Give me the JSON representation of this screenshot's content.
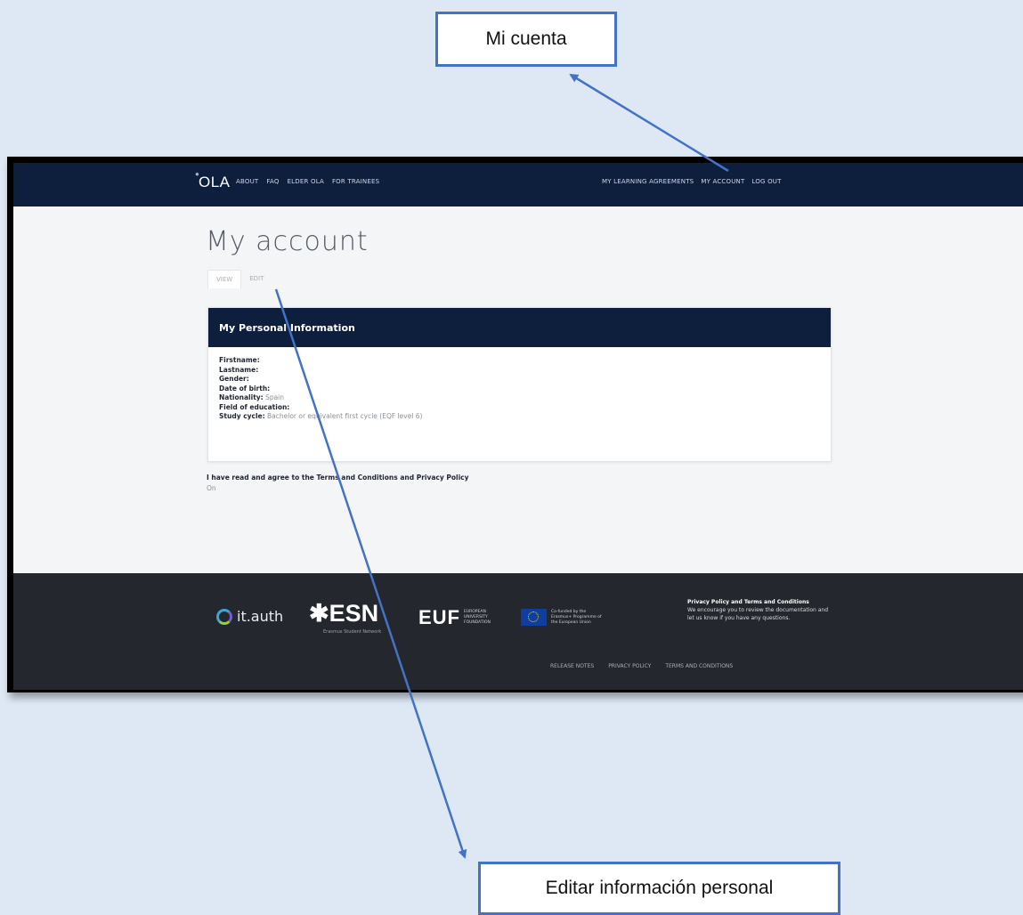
{
  "callouts": {
    "top": "Mi cuenta",
    "bottom": "Editar información personal"
  },
  "header": {
    "logo": "OLA",
    "nav_left": [
      "ABOUT",
      "FAQ",
      "ELDER OLA",
      "FOR TRAINEES"
    ],
    "nav_right": [
      "MY LEARNING AGREEMENTS",
      "MY ACCOUNT",
      "LOG OUT"
    ]
  },
  "page": {
    "title": "My account",
    "tabs": [
      "VIEW",
      "EDIT"
    ]
  },
  "panel": {
    "title": "My Personal Information",
    "fields": [
      {
        "label": "Firstname:",
        "value": ""
      },
      {
        "label": "Lastname:",
        "value": ""
      },
      {
        "label": "Gender:",
        "value": ""
      },
      {
        "label": "Date of birth:",
        "value": ""
      },
      {
        "label": "Nationality:",
        "value": "Spain"
      },
      {
        "label": "Field of education:",
        "value": ""
      },
      {
        "label": "Study cycle:",
        "value": "Bachelor or equivalent first cycle (EQF level 6)"
      }
    ]
  },
  "terms": {
    "label": "I have read and agree to the Terms and Conditions and Privacy Policy",
    "value": "On"
  },
  "footer": {
    "itauth": "it.auth",
    "esn": "✱ESN",
    "esn_sub": "Erasmus Student Network",
    "euf": "EUF",
    "euf_text": "EUROPEAN UNIVERSITY FOUNDATION",
    "eu_text": "Co-funded by the Erasmus+ Programme of the European Union",
    "info_title": "Privacy Policy and Terms and Conditions",
    "info_text": "We encourage you to review the documentation and let us know if you have any questions.",
    "links": [
      "RELEASE NOTES",
      "PRIVACY POLICY",
      "TERMS AND CONDITIONS"
    ]
  },
  "colors": {
    "background": "#dde8f4",
    "navbar": "#0e1e3d",
    "arrow": "#4472c4",
    "footer": "#24272d"
  }
}
